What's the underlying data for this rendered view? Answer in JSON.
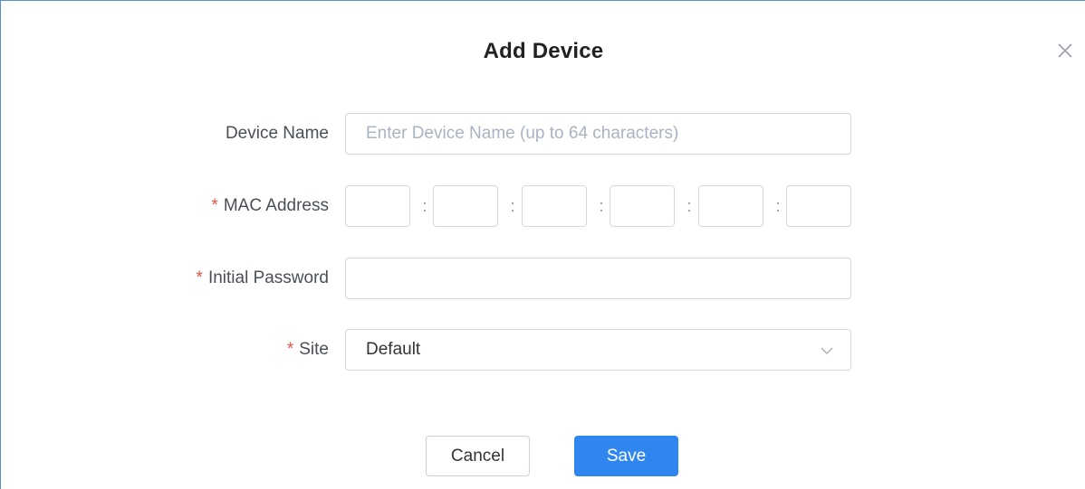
{
  "dialog": {
    "title": "Add Device",
    "close_icon": "close-icon"
  },
  "form": {
    "device_name": {
      "label": "Device Name",
      "value": "",
      "placeholder": "Enter Device Name (up to 64 characters)",
      "required": false
    },
    "mac_address": {
      "label": "MAC Address",
      "required_mark": "*",
      "separator": ":",
      "octets": [
        "",
        "",
        "",
        "",
        "",
        ""
      ]
    },
    "initial_password": {
      "label": "Initial Password",
      "required_mark": "*",
      "value": ""
    },
    "site": {
      "label": "Site",
      "required_mark": "*",
      "selected": "Default",
      "dropdown_icon": "chevron-down-icon"
    }
  },
  "actions": {
    "cancel_label": "Cancel",
    "save_label": "Save"
  },
  "colors": {
    "primary": "#2f86ef",
    "required": "#e5534b",
    "border": "#d5d9df",
    "placeholder": "#a9b3c2"
  }
}
